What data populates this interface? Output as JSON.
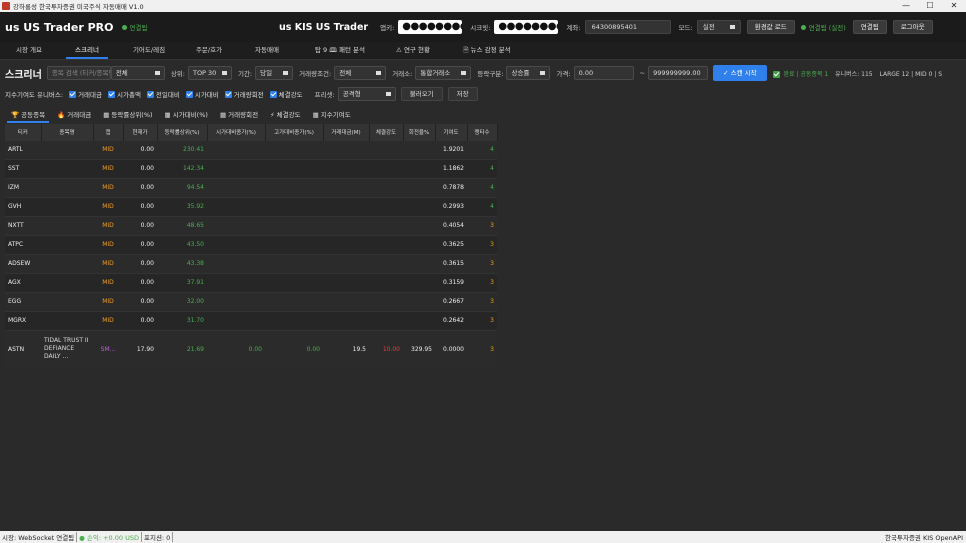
{
  "window": {
    "title": "강하룡성 한국투자증권 미국주식 자동매매 V1.0",
    "minimize": "—",
    "maximize": "☐",
    "close": "✕"
  },
  "header": {
    "brand": "us US Trader PRO",
    "conn_label": "연결됨",
    "kis_title": "us KIS US Trader",
    "appkey_label": "앱키:",
    "appkey_value": "●●●●●●●●●●",
    "secret_label": "시크릿:",
    "secret_value": "●●●●●●●●●●",
    "account_label": "계좌:",
    "account_value": "64300895401",
    "mode_label": "모드:",
    "mode_value": "실전",
    "env_load_btn": "환경값 로드",
    "status_text": "연결됨 (실전)",
    "connect_btn": "연결됨",
    "logout_btn": "로그아웃"
  },
  "main_tabs": [
    "시장 개요",
    "스크리너",
    "기어도/레짐",
    "주문/호가",
    "자동매매",
    "탑 9 🕮 패턴 분석",
    "⚠ 연구 현황",
    "🗎 뉴스 감정 분석"
  ],
  "screener": {
    "title": "스크리너",
    "search_placeholder": "종목 검색 (티커/종목명)",
    "search_scope": "전체",
    "rank_label": "상위:",
    "rank_value": "TOP 30",
    "period_label": "기간:",
    "period_value": "당일",
    "volume_cond_label": "거래량조건:",
    "volume_cond_value": "전체",
    "exchange_label": "거래소:",
    "exchange_value": "통합거래소",
    "change_label": "등락구분:",
    "change_value": "상승률",
    "price_label": "가격:",
    "price_min": "0.00",
    "price_sep": "~",
    "price_max": "999999999.00",
    "scan_btn": "✓ 스캔 시작",
    "status_done": "완료 | 공동종목 1",
    "status_universe": "유니버스: 115",
    "status_caps": "LARGE 12 | MID 0 | S"
  },
  "options": {
    "universe_label": "지수기여도 유니버스:",
    "checks": [
      "거래대금",
      "시가총액",
      "전일대비",
      "시가대비",
      "거래량회전",
      "체결강도"
    ],
    "preset_label": "프리셋:",
    "preset_value": "공격형",
    "load_btn": "불러오기",
    "save_btn": "저장"
  },
  "sub_tabs": [
    "🏆 공동종목",
    "🔥 거래대금",
    "▦ 등락률상위(%)",
    "▦ 시가대비(%)",
    "▦ 거래량회전",
    "⚡ 체결강도",
    "▦ 지수기여도"
  ],
  "table": {
    "columns": [
      "티커",
      "종목명",
      "캡",
      "현재가",
      "등락률상위(%)",
      "시가대비종가(%)",
      "고가대비종가(%)",
      "거래대금(M)",
      "체결강도",
      "회전율%",
      "기여도",
      "랭타수"
    ],
    "rows": [
      {
        "ticker": "ARTL",
        "name": "",
        "cap": "MID",
        "price": "0.00",
        "chg": "230.41",
        "open": "",
        "high": "",
        "amount": "",
        "strength": "",
        "turnover": "",
        "contrib": "1.9201",
        "rank": "4"
      },
      {
        "ticker": "SST",
        "name": "",
        "cap": "MID",
        "price": "0.00",
        "chg": "142.34",
        "open": "",
        "high": "",
        "amount": "",
        "strength": "",
        "turnover": "",
        "contrib": "1.1862",
        "rank": "4"
      },
      {
        "ticker": "IZM",
        "name": "",
        "cap": "MID",
        "price": "0.00",
        "chg": "94.54",
        "open": "",
        "high": "",
        "amount": "",
        "strength": "",
        "turnover": "",
        "contrib": "0.7878",
        "rank": "4"
      },
      {
        "ticker": "GVH",
        "name": "",
        "cap": "MID",
        "price": "0.00",
        "chg": "35.92",
        "open": "",
        "high": "",
        "amount": "",
        "strength": "",
        "turnover": "",
        "contrib": "0.2993",
        "rank": "4"
      },
      {
        "ticker": "NXTT",
        "name": "",
        "cap": "MID",
        "price": "0.00",
        "chg": "48.65",
        "open": "",
        "high": "",
        "amount": "",
        "strength": "",
        "turnover": "",
        "contrib": "0.4054",
        "rank": "3"
      },
      {
        "ticker": "ATPC",
        "name": "",
        "cap": "MID",
        "price": "0.00",
        "chg": "43.50",
        "open": "",
        "high": "",
        "amount": "",
        "strength": "",
        "turnover": "",
        "contrib": "0.3625",
        "rank": "3"
      },
      {
        "ticker": "ADSEW",
        "name": "",
        "cap": "MID",
        "price": "0.00",
        "chg": "43.38",
        "open": "",
        "high": "",
        "amount": "",
        "strength": "",
        "turnover": "",
        "contrib": "0.3615",
        "rank": "3"
      },
      {
        "ticker": "AGX",
        "name": "",
        "cap": "MID",
        "price": "0.00",
        "chg": "37.91",
        "open": "",
        "high": "",
        "amount": "",
        "strength": "",
        "turnover": "",
        "contrib": "0.3159",
        "rank": "3"
      },
      {
        "ticker": "EGG",
        "name": "",
        "cap": "MID",
        "price": "0.00",
        "chg": "32.00",
        "open": "",
        "high": "",
        "amount": "",
        "strength": "",
        "turnover": "",
        "contrib": "0.2667",
        "rank": "3"
      },
      {
        "ticker": "MGRX",
        "name": "",
        "cap": "MID",
        "price": "0.00",
        "chg": "31.70",
        "open": "",
        "high": "",
        "amount": "",
        "strength": "",
        "turnover": "",
        "contrib": "0.2642",
        "rank": "3"
      },
      {
        "ticker": "ASTN",
        "name": "TIDAL TRUST II DEFIANCE DAILY ...",
        "cap": "SM...",
        "price": "17.90",
        "chg": "21.69",
        "open": "0.00",
        "high": "0.00",
        "amount": "19.5",
        "strength": "10.00",
        "turnover": "329.95",
        "contrib": "0.0000",
        "rank": "3"
      }
    ]
  },
  "statusbar": {
    "ws": "시장: WebSocket 연결됨",
    "pnl": "● 손익: +0.00 USD",
    "position": "포지션: 0",
    "right": "한국투자증권 KIS OpenAPI"
  },
  "colors": {
    "accent": "#2f80ed",
    "up": "#4caf50",
    "mid_cap": "#f0a020",
    "small_cap": "#c060e0",
    "down": "#e04040"
  }
}
